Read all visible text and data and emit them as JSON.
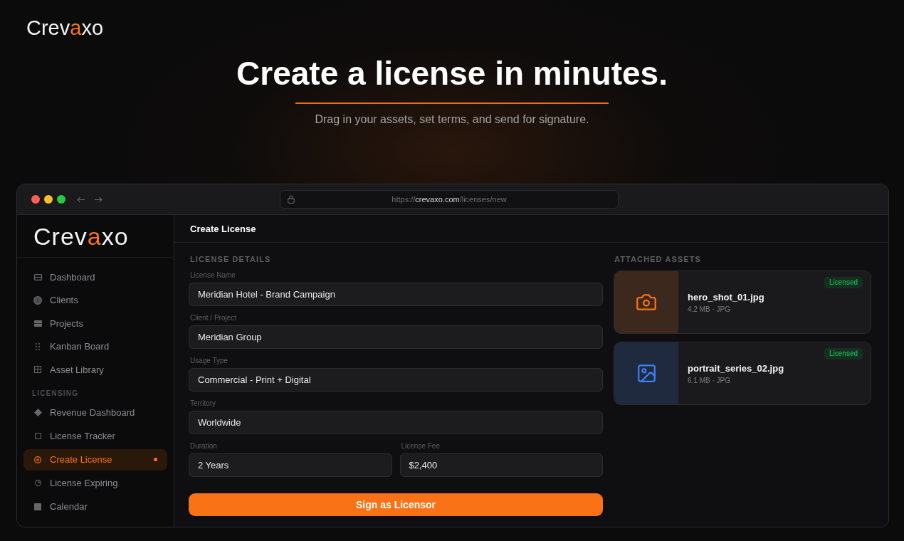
{
  "brand": {
    "logo": {
      "start": "Crev",
      "accent": "a",
      "end": "xo"
    }
  },
  "hero": {
    "title": "Create a license in minutes.",
    "subtitle": "Drag in your assets, set terms, and send for signature."
  },
  "browser": {
    "url": {
      "scheme": "https://",
      "domain": "crevaxo.com",
      "path": "/licenses/new"
    }
  },
  "sidebar": {
    "logo": {
      "start": "Crev",
      "accent": "a",
      "end": "xo"
    },
    "groups": [
      {
        "items": [
          {
            "label": "Dashboard",
            "selected": false
          },
          {
            "label": "Clients",
            "selected": false
          },
          {
            "label": "Projects",
            "selected": false
          },
          {
            "label": "Kanban Board",
            "selected": false
          },
          {
            "label": "Asset Library",
            "selected": false
          }
        ]
      },
      {
        "heading": "LICENSING",
        "items": [
          {
            "label": "Revenue Dashboard",
            "selected": false
          },
          {
            "label": "License Tracker",
            "selected": false
          },
          {
            "label": "Create License",
            "selected": true
          },
          {
            "label": "License Expiring",
            "selected": false
          },
          {
            "label": "Calendar",
            "selected": false
          }
        ]
      }
    ]
  },
  "main": {
    "title": "Create License",
    "details": {
      "heading": "LICENSE DETAILS",
      "rows": [
        {
          "fields": [
            {
              "label": "License Name",
              "value": "Meridian Hotel - Brand Campaign"
            }
          ]
        },
        {
          "fields": [
            {
              "label": "Client / Project",
              "value": "Meridian Group"
            }
          ]
        },
        {
          "fields": [
            {
              "label": "Usage Type",
              "value": "Commercial - Print + Digital"
            }
          ]
        },
        {
          "fields": [
            {
              "label": "Territory",
              "value": "Worldwide"
            }
          ]
        },
        {
          "fields": [
            {
              "label": "Duration",
              "value": "2 Years"
            },
            {
              "label": "License Fee",
              "value": "$2,400"
            }
          ]
        }
      ],
      "submit": "Sign as Licensor"
    },
    "assets": {
      "heading": "ATTACHED ASSETS",
      "items": [
        {
          "name": "hero_shot_01.jpg",
          "meta": "4.2 MB · JPG",
          "badge": "Licensed",
          "color": "#f97316"
        },
        {
          "name": "portrait_series_02.jpg",
          "meta": "6.1 MB · JPG",
          "badge": "Licensed",
          "color": "#3b82f6"
        }
      ]
    }
  }
}
